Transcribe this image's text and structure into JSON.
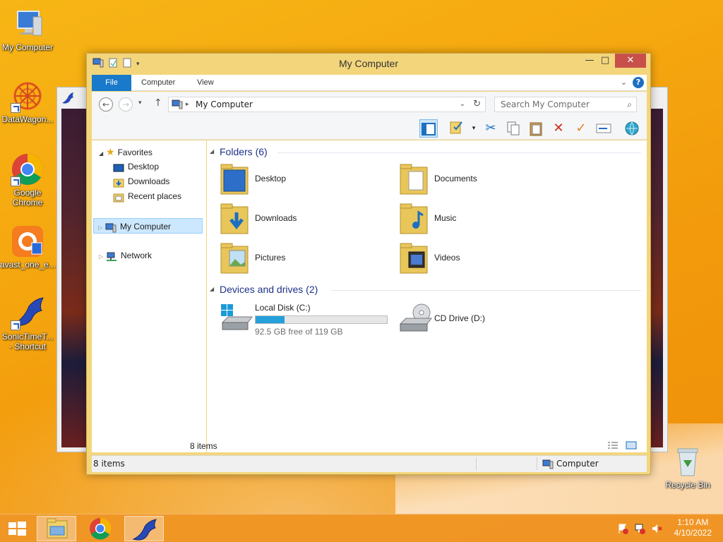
{
  "desktop": {
    "icons": [
      {
        "label": "My Computer",
        "icon": "computer-icon"
      },
      {
        "label": "DataWagon...",
        "icon": "datawagon-icon"
      },
      {
        "label": "Google Chrome",
        "icon": "chrome-icon"
      },
      {
        "label": "avast_one_e...",
        "icon": "avast-icon"
      },
      {
        "label": "SonicTimeT... - Shortcut",
        "icon": "sonic-icon"
      }
    ],
    "recycle_bin": "Recycle Bin"
  },
  "window": {
    "title": "My Computer",
    "controls": {
      "minimize": "—",
      "maximize": "□",
      "close": "✕"
    },
    "ribbon_tabs": [
      "File",
      "Computer",
      "View"
    ],
    "address": "My Computer",
    "search_placeholder": "Search My Computer"
  },
  "navpane": {
    "favorites": "Favorites",
    "favorite_items": [
      "Desktop",
      "Downloads",
      "Recent places"
    ],
    "my_computer": "My Computer",
    "network": "Network"
  },
  "content": {
    "folders_header": "Folders (6)",
    "folders": [
      "Desktop",
      "Documents",
      "Downloads",
      "Music",
      "Pictures",
      "Videos"
    ],
    "drives_header": "Devices and drives (2)",
    "drives": [
      {
        "name": "Local Disk (C:)",
        "free": "92.5 GB free of 119 GB",
        "used_fraction": 0.22
      },
      {
        "name": "CD Drive (D:)"
      }
    ],
    "item_count": "8 items"
  },
  "statusbar": {
    "left": "8 items",
    "right": "Computer"
  },
  "taskbar": {
    "time": "1:10 AM",
    "date": "4/10/2022"
  },
  "colors": {
    "accent": "#1979ca",
    "desktop_bg": "#f5a70f",
    "progress_fill": "#26a0da"
  }
}
